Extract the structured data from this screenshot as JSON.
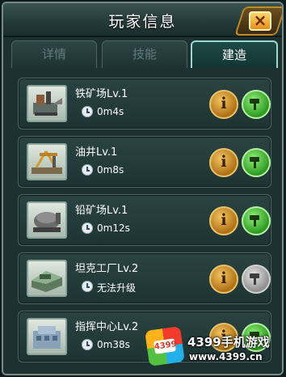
{
  "window": {
    "title": "玩家信息",
    "close_label": "×"
  },
  "tabs": [
    {
      "label": "详情",
      "active": false
    },
    {
      "label": "技能",
      "active": false
    },
    {
      "label": "建造",
      "active": true
    }
  ],
  "buildings": [
    {
      "name": "铁矿场Lv.1",
      "time": "0m4s",
      "icon": "iron-mine-icon",
      "upgradable": true
    },
    {
      "name": "油井Lv.1",
      "time": "0m8s",
      "icon": "oil-well-icon",
      "upgradable": true
    },
    {
      "name": "铅矿场Lv.1",
      "time": "0m12s",
      "icon": "lead-mine-icon",
      "upgradable": true
    },
    {
      "name": "坦克工厂Lv.2",
      "time": "无法升级",
      "icon": "tank-factory-icon",
      "upgradable": false
    },
    {
      "name": "指挥中心Lv.2",
      "time": "0m38s",
      "icon": "command-center-icon",
      "upgradable": true
    }
  ],
  "buttons": {
    "info_label": "i"
  },
  "colors": {
    "info_button": "#d9951f",
    "upgrade_button": "#4cc23a",
    "upgrade_disabled": "#a9a9a9",
    "active_tab_border": "#9fd6d0"
  },
  "watermark": {
    "logo_text": "4399",
    "line1": "4399手机游戏",
    "line2": "www.4399.cn"
  }
}
